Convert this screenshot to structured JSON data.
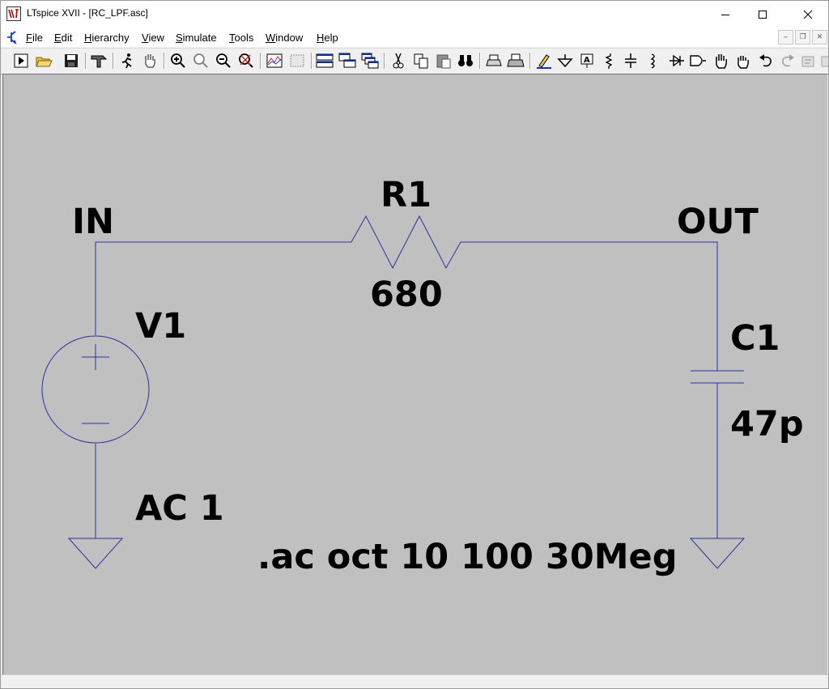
{
  "window": {
    "title": "LTspice XVII - [RC_LPF.asc]"
  },
  "menu": [
    {
      "label": "File",
      "key": "F",
      "rest": "ile"
    },
    {
      "label": "Edit",
      "key": "E",
      "rest": "dit"
    },
    {
      "label": "Hierarchy",
      "key": "H",
      "rest": "ierarchy"
    },
    {
      "label": "View",
      "key": "V",
      "rest": "iew"
    },
    {
      "label": "Simulate",
      "key": "S",
      "rest": "imulate"
    },
    {
      "label": "Tools",
      "key": "T",
      "rest": "ools"
    },
    {
      "label": "Window",
      "key": "W",
      "rest": "indow"
    },
    {
      "label": "Help",
      "key": "H",
      "rest": "elp"
    }
  ],
  "toolbar": [
    "run-icon",
    "open-icon",
    "save-icon",
    "control-panel-icon",
    "halt-icon",
    "pan-icon",
    "zoom-in-icon",
    "zoom-area-icon",
    "zoom-out-icon",
    "zoom-fit-icon",
    "waveform-icon",
    "waveform-autorange-icon",
    "tile-horizontal-icon",
    "tile-vertical-icon",
    "cascade-icon",
    "cut-icon",
    "copy-icon",
    "paste-icon",
    "find-icon",
    "print-setup-icon",
    "print-icon",
    "wire-icon",
    "ground-icon",
    "label-icon",
    "resistor-icon",
    "capacitor-icon",
    "inductor-icon",
    "diode-icon",
    "component-icon",
    "move-icon",
    "drag-icon",
    "undo-icon",
    "redo-icon",
    "text-icon",
    "spice-directive-icon"
  ],
  "schematic": {
    "wire_color": "#2f2fa0",
    "text_color": "#000000",
    "canvas_color": "#c0c0c0",
    "net_in": "IN",
    "net_out": "OUT",
    "r1": {
      "name": "R1",
      "value": "680"
    },
    "v1": {
      "name": "V1",
      "value": "AC 1"
    },
    "c1": {
      "name": "C1",
      "value": "47p"
    },
    "directive": ".ac oct 10 100 30Meg"
  }
}
